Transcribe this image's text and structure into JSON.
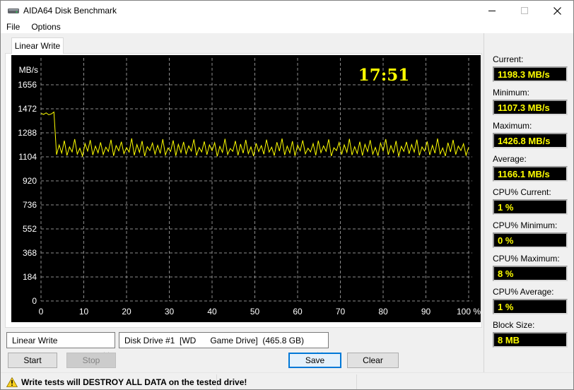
{
  "window": {
    "title": "AIDA64 Disk Benchmark",
    "controls": {
      "minimize": "minimize",
      "maximize": "maximize",
      "close": "close"
    }
  },
  "menu": {
    "items": [
      "File",
      "Options"
    ]
  },
  "tabs": {
    "active": "Linear Write"
  },
  "chart_data": {
    "type": "line",
    "title": "Linear Write benchmark speed over disk span",
    "ylabel": "MB/s",
    "xlabel": "",
    "x_unit": "%",
    "xlim": [
      0,
      100
    ],
    "ylim": [
      0,
      1840
    ],
    "x_ticks": [
      0,
      10,
      20,
      30,
      40,
      50,
      60,
      70,
      80,
      90,
      100
    ],
    "x_tick_labels": [
      "0",
      "10",
      "20",
      "30",
      "40",
      "50",
      "60",
      "70",
      "80",
      "90",
      "100 %"
    ],
    "y_ticks": [
      0,
      184,
      368,
      552,
      736,
      920,
      1104,
      1288,
      1472,
      1656
    ],
    "grid": "dashed",
    "grid_color": "#8c8c8c",
    "axis_text_color": "#ffffff",
    "line_color": "#ffff00",
    "bg": "#000000",
    "timer": "17:51",
    "series": [
      {
        "name": "Linear Write",
        "values": [
          1437,
          1429,
          1441,
          1426,
          1433,
          1447,
          1120,
          1195,
          1132,
          1228,
          1115,
          1180,
          1142,
          1240,
          1125,
          1170,
          1110,
          1205,
          1148,
          1232,
          1118,
          1186,
          1135,
          1215,
          1122,
          1178,
          1145,
          1235,
          1112,
          1190,
          1150,
          1220,
          1128,
          1175,
          1140,
          1245,
          1116,
          1198,
          1138,
          1225,
          1110,
          1182,
          1152,
          1210,
          1124,
          1192,
          1130,
          1240,
          1118,
          1172,
          1145,
          1230,
          1112,
          1200,
          1136,
          1218,
          1126,
          1188,
          1148,
          1238,
          1114,
          1176,
          1142,
          1222,
          1120,
          1196,
          1152,
          1212,
          1108,
          1184,
          1138,
          1242,
          1122,
          1168,
          1146,
          1226,
          1116,
          1202,
          1132,
          1234,
          1128,
          1180,
          1110,
          1208,
          1144,
          1190,
          1124,
          1236,
          1140,
          1178,
          1114,
          1216,
          1148,
          1244,
          1118,
          1186,
          1134,
          1224,
          1112,
          1194,
          1150,
          1230,
          1126,
          1170,
          1142,
          1206,
          1116,
          1228,
          1136,
          1188,
          1146,
          1238,
          1110,
          1174,
          1152,
          1214,
          1122,
          1196,
          1138,
          1242,
          1118,
          1182,
          1130,
          1220,
          1114,
          1200,
          1144,
          1232,
          1124,
          1176,
          1112,
          1210,
          1150,
          1240,
          1120,
          1190,
          1136,
          1226,
          1108,
          1184,
          1146,
          1218,
          1128,
          1198,
          1140,
          1236,
          1115,
          1180,
          1148,
          1222,
          1118,
          1192,
          1132,
          1244,
          1126,
          1172,
          1110,
          1212,
          1142,
          1234,
          1122,
          1186,
          1152,
          1204,
          1116,
          1178
        ]
      }
    ]
  },
  "stats": {
    "groups": [
      {
        "id": "current",
        "label": "Current:",
        "value": "1198.3 MB/s"
      },
      {
        "id": "minimum",
        "label": "Minimum:",
        "value": "1107.3 MB/s"
      },
      {
        "id": "maximum",
        "label": "Maximum:",
        "value": "1426.8 MB/s"
      },
      {
        "id": "average",
        "label": "Average:",
        "value": "1166.1 MB/s"
      },
      {
        "id": "cpu-current",
        "label": "CPU% Current:",
        "value": "1 %"
      },
      {
        "id": "cpu-minimum",
        "label": "CPU% Minimum:",
        "value": "0 %"
      },
      {
        "id": "cpu-maximum",
        "label": "CPU% Maximum:",
        "value": "8 %"
      },
      {
        "id": "cpu-average",
        "label": "CPU% Average:",
        "value": "1 %"
      },
      {
        "id": "block-size",
        "label": "Block Size:",
        "value": "8 MB"
      }
    ]
  },
  "controls": {
    "test_select": {
      "value": "Linear Write"
    },
    "drive_select": {
      "value": "Disk Drive #1  [WD      Game Drive]  (465.8 GB)"
    },
    "buttons": {
      "start": "Start",
      "stop": "Stop",
      "save": "Save",
      "clear": "Clear"
    }
  },
  "statusbar": {
    "warning": "Write tests will DESTROY ALL DATA on the tested drive!"
  },
  "colors": {
    "accent": "#ffff00",
    "plot_bg": "#000000",
    "default_button_border": "#0078d7"
  }
}
